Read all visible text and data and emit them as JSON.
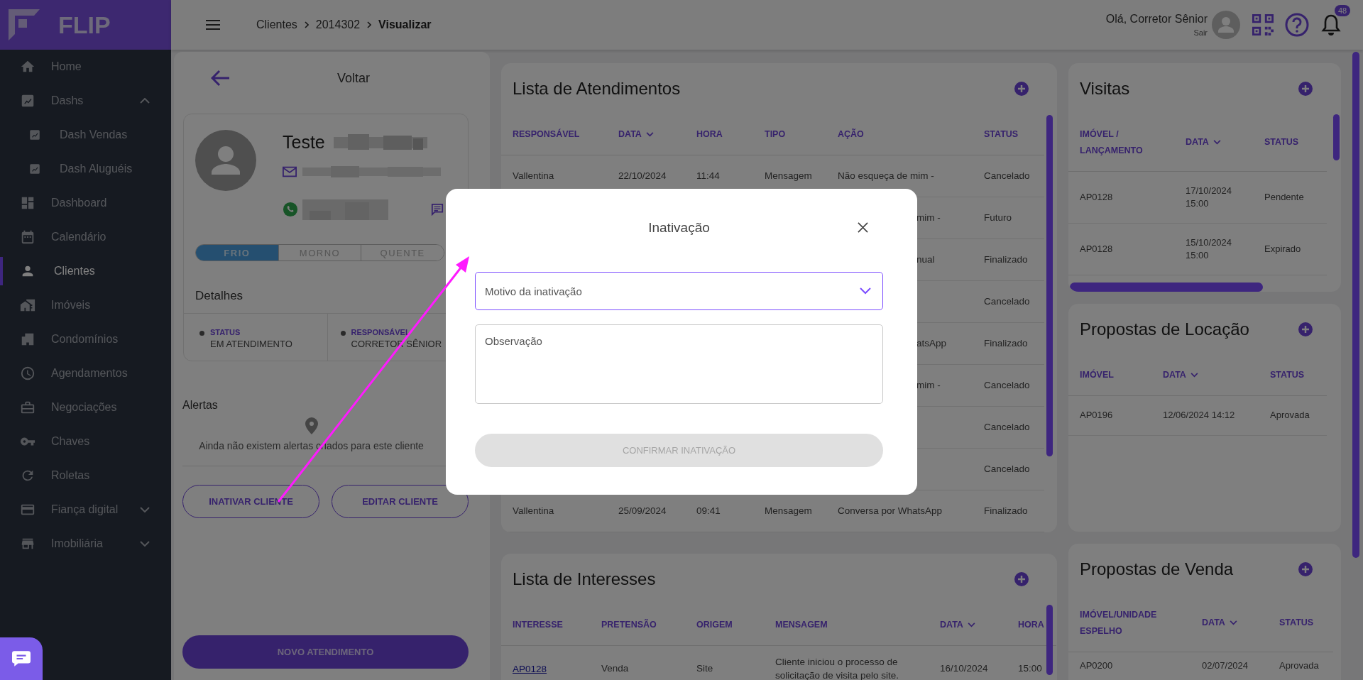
{
  "sidebar": {
    "logo": "FLIP",
    "items": [
      {
        "label": "Home",
        "selected": false
      },
      {
        "label": "Dashs",
        "selected": false,
        "expanded": true,
        "children": [
          {
            "label": "Dash Vendas",
            "selected": false
          },
          {
            "label": "Dash Aluguéis",
            "selected": false
          }
        ]
      },
      {
        "label": "Dashboard",
        "selected": false
      },
      {
        "label": "Calendário",
        "selected": false
      },
      {
        "label": "Clientes",
        "selected": true
      },
      {
        "label": "Imóveis",
        "selected": false
      },
      {
        "label": "Condomínios",
        "selected": false
      },
      {
        "label": "Agendamentos",
        "selected": false
      },
      {
        "label": "Negociações",
        "selected": false
      },
      {
        "label": "Chaves",
        "selected": false
      },
      {
        "label": "Roletas",
        "selected": false
      },
      {
        "label": "Fiança digital",
        "selected": false,
        "expanded": false
      },
      {
        "label": "Imobiliária",
        "selected": false,
        "expanded": false
      }
    ]
  },
  "header": {
    "breadcrumb": [
      "Clientes",
      "2014302",
      "Visualizar"
    ],
    "greeting": "Olá, Corretor Sênior",
    "logout": "Sair",
    "notification_count": "48"
  },
  "client_panel": {
    "back": "Voltar",
    "name": "Teste",
    "temperature": [
      {
        "label": "FRIO",
        "selected": true
      },
      {
        "label": "MORNO",
        "selected": false
      },
      {
        "label": "QUENTE",
        "selected": false
      }
    ],
    "details_title": "Detalhes",
    "details": [
      {
        "label": "STATUS",
        "value": "EM ATENDIMENTO"
      },
      {
        "label": "RESPONSÁVEL",
        "value": "CORRETOR SÊNIOR"
      }
    ],
    "alerts_title": "Alertas",
    "alerts_empty": "Ainda não existem alertas criados para este cliente",
    "buttons": [
      "INATIVAR CLIENTE",
      "EDITAR CLIENTE"
    ],
    "primary_button": "NOVO ATENDIMENTO"
  },
  "middle_cards": [
    {
      "title": "Lista de Atendimentos",
      "columns": [
        {
          "label": "RESPONSÁVEL",
          "sortable": false
        },
        {
          "label": "DATA",
          "sortable": true
        },
        {
          "label": "HORA",
          "sortable": false
        },
        {
          "label": "TIPO",
          "sortable": false
        },
        {
          "label": "AÇÃO",
          "sortable": false
        },
        {
          "label": "STATUS",
          "sortable": false
        }
      ],
      "rows": [
        [
          "Vallentina",
          "22/10/2024",
          "11:44",
          "Mensagem",
          "Não esqueça de mim -",
          "Cancelado"
        ],
        [
          null,
          null,
          null,
          null,
          {
            "text": "mim -",
            "partial": true
          },
          "Futuro"
        ],
        [
          null,
          null,
          null,
          null,
          {
            "text": "nual",
            "partial": true
          },
          "Finalizado"
        ],
        [
          null,
          null,
          null,
          null,
          null,
          "Cancelado"
        ],
        [
          null,
          null,
          null,
          null,
          {
            "text": "atsApp",
            "partial": true
          },
          "Finalizado"
        ],
        [
          null,
          null,
          null,
          null,
          {
            "text": "mim -",
            "partial": true
          },
          "Cancelado"
        ],
        [
          null,
          null,
          null,
          null,
          null,
          "Cancelado"
        ],
        [
          null,
          null,
          null,
          null,
          null,
          "Cancelado"
        ],
        [
          "Vallentina",
          "25/09/2024",
          "09:41",
          "Mensagem",
          "Conversa por WhatsApp",
          "Finalizado"
        ]
      ]
    },
    {
      "title": "Lista de Interesses",
      "columns": [
        {
          "label": "INTERESSE",
          "sortable": false
        },
        {
          "label": "PRETENSÃO",
          "sortable": false
        },
        {
          "label": "ORIGEM",
          "sortable": false
        },
        {
          "label": "MENSAGEM",
          "sortable": false
        },
        {
          "label": "DATA",
          "sortable": true
        },
        {
          "label": "HORA",
          "sortable": false
        }
      ],
      "rows": [
        [
          {
            "text": "AP0128",
            "link": true
          },
          "Venda",
          "Site",
          "Cliente iniciou o processo de solicitação de visita pelo site.",
          "16/10/2024",
          "15:00"
        ]
      ]
    }
  ],
  "side_cards": [
    {
      "title": "Visitas",
      "columns": [
        {
          "label": "IMÓVEL / LANÇAMENTO",
          "sortable": false
        },
        {
          "label": "DATA",
          "sortable": true
        },
        {
          "label": "STATUS",
          "sortable": false
        }
      ],
      "rows": [
        [
          "AP0128",
          "17/10/2024 15:00",
          "Pendente"
        ],
        [
          "AP0128",
          "15/10/2024 15:00",
          "Expirado"
        ]
      ]
    },
    {
      "title": "Propostas de Locação",
      "columns": [
        {
          "label": "IMÓVEL",
          "sortable": false
        },
        {
          "label": "DATA",
          "sortable": true
        },
        {
          "label": "STATUS",
          "sortable": false
        }
      ],
      "rows": [
        [
          "AP0196",
          "12/06/2024 14:12",
          "Aprovada"
        ]
      ]
    },
    {
      "title": "Propostas de Venda",
      "columns": [
        {
          "label": "IMÓVEL/UNIDADE ESPELHO",
          "sortable": false
        },
        {
          "label": "DATA",
          "sortable": true
        },
        {
          "label": "STATUS",
          "sortable": false
        }
      ],
      "rows": [
        [
          "AP0200",
          "02/07/2024",
          "Aprovada"
        ]
      ]
    }
  ],
  "modal": {
    "title": "Inativação",
    "reason": {
      "placeholder": "Motivo da inativação"
    },
    "note": {
      "placeholder": "Observação"
    },
    "confirm": {
      "label": "CONFIRMAR INATIVAÇÃO",
      "disabled": true
    }
  }
}
